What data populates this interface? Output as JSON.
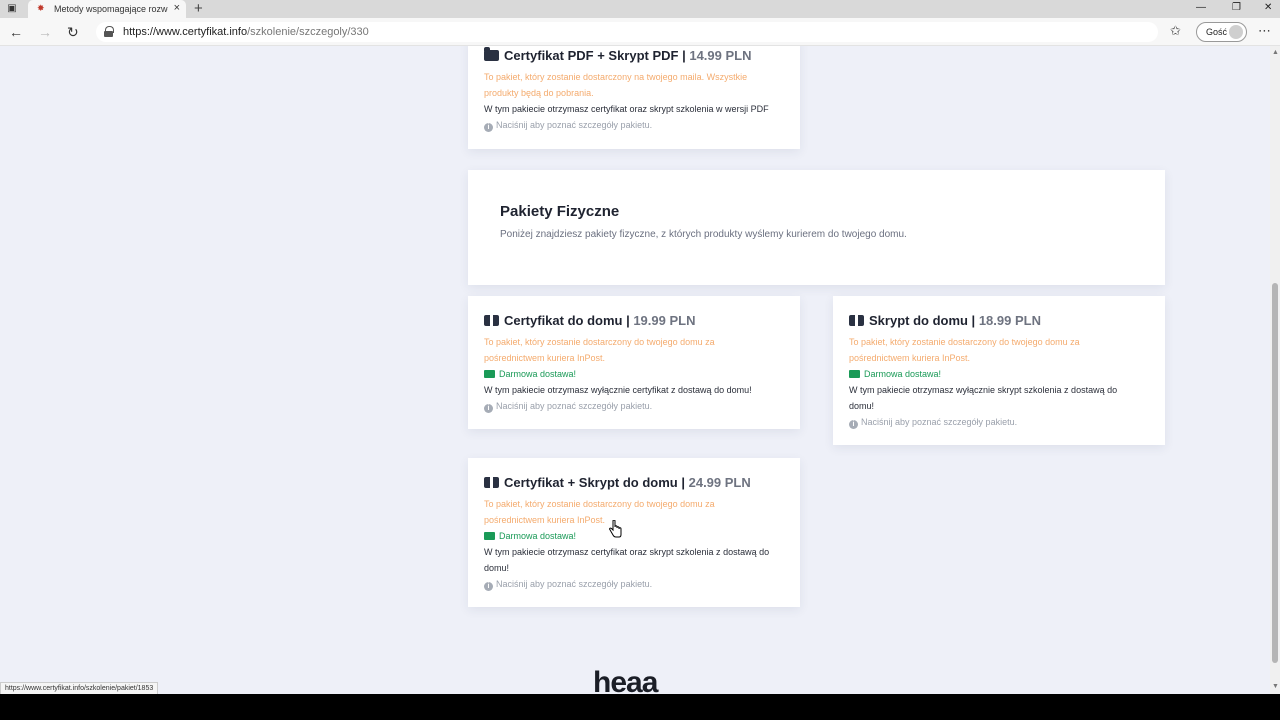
{
  "browser": {
    "tab_title": "Metody wspomagające rozwój r...",
    "url_domain": "https://www.certyfikat.info",
    "url_path": "/szkolenie/szczegoly/330",
    "guest_label": "Gość",
    "status_url": "https://www.certyfikat.info/szkolenie/pakiet/1853"
  },
  "pdf_package": {
    "title": "Certyfikat PDF + Skrypt PDF |",
    "price": "14.99 PLN",
    "delivery_line1": "To pakiet, który zostanie dostarczony na twojego maila. Wszystkie",
    "delivery_line2": "produkty będą do pobrania.",
    "description": "W tym pakiecie otrzymasz certyfikat oraz skrypt szkolenia w wersji PDF",
    "details_hint": "Naciśnij aby poznać szczegóły pakietu."
  },
  "physical_section": {
    "title": "Pakiety Fizyczne",
    "subtitle": "Poniżej znajdziesz pakiety fizyczne, z których produkty wyślemy kurierem do twojego domu."
  },
  "packages": [
    {
      "title": "Certyfikat do domu |",
      "price": "19.99 PLN",
      "delivery_line1": "To pakiet, który zostanie dostarczony do twojego domu za",
      "delivery_line2": "pośrednictwem kuriera InPost.",
      "free_shipping": "Darmowa dostawa!",
      "description_line1": "W tym pakiecie otrzymasz wyłącznie certyfikat z dostawą do domu!",
      "description_line2": "",
      "details_hint": "Naciśnij aby poznać szczegóły pakietu."
    },
    {
      "title": "Skrypt do domu |",
      "price": "18.99 PLN",
      "delivery_line1": "To pakiet, który zostanie dostarczony do twojego domu za",
      "delivery_line2": "pośrednictwem kuriera InPost.",
      "free_shipping": "Darmowa dostawa!",
      "description_line1": "W tym pakiecie otrzymasz wyłącznie skrypt szkolenia z dostawą do",
      "description_line2": "domu!",
      "details_hint": "Naciśnij aby poznać szczegóły pakietu."
    },
    {
      "title": "Certyfikat + Skrypt do domu |",
      "price": "24.99 PLN",
      "delivery_line1": "To pakiet, który zostanie dostarczony do twojego domu za",
      "delivery_line2": "pośrednictwem kuriera InPost.",
      "free_shipping": "Darmowa dostawa!",
      "description_line1": "W tym pakiecie otrzymasz certyfikat oraz skrypt szkolenia z dostawą do",
      "description_line2": "domu!",
      "details_hint": "Naciśnij aby poznać szczegóły pakietu."
    }
  ],
  "footer": {
    "logo": "heaa"
  },
  "colors": {
    "page_bg": "#eef0f8",
    "delivery_text": "#f4ab6e",
    "free_shipping": "#1a9a57",
    "price_text": "#6e7380"
  },
  "icons": {
    "pdf_package": "folder-open-icon",
    "physical_package": "box-open-icon",
    "shipping": "truck-icon",
    "info": "info-circle-icon"
  }
}
